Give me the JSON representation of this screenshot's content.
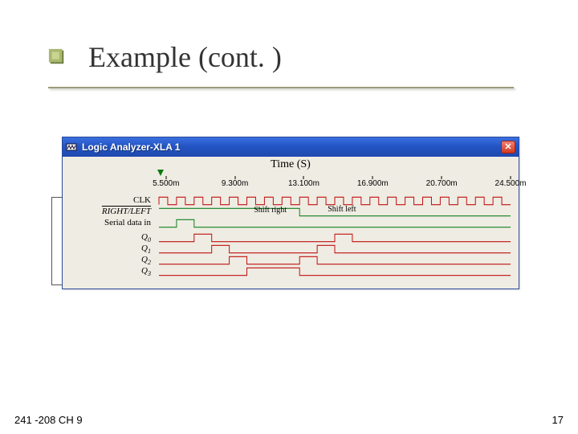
{
  "title": "Example (cont. )",
  "window": {
    "title": "Logic Analyzer-XLA 1",
    "close_glyph": "✕"
  },
  "chart": {
    "title": "Time (S)",
    "ticks": [
      "5.500m",
      "9.300m",
      "13.100m",
      "16.900m",
      "20.700m",
      "24.500m"
    ]
  },
  "signals": {
    "clk": "CLK",
    "rl": "RIGHT/LEFT",
    "sdi": "Serial data in",
    "q0": "Q",
    "q0s": "0",
    "q1": "Q",
    "q1s": "1",
    "q2": "Q",
    "q2s": "2",
    "q3": "Q",
    "q3s": "3"
  },
  "annot": {
    "shift_right": "Shift right",
    "shift_left": "Shift left"
  },
  "footer": {
    "left": "241 -208 CH 9",
    "right": "17"
  },
  "chart_data": {
    "type": "timing-diagram",
    "x_unit": "ms",
    "x_range": [
      5.5,
      24.5
    ],
    "ticks_ms": [
      5.5,
      9.3,
      13.1,
      16.9,
      20.7,
      24.5
    ],
    "signals": [
      {
        "name": "CLK",
        "type": "clock",
        "period_ms": 0.95,
        "color": "#c01010"
      },
      {
        "name": "RIGHT_LEFT",
        "type": "digital",
        "edges_ms": [
          [
            5.5,
            1
          ],
          [
            13.1,
            0
          ]
        ],
        "color": "#108020"
      },
      {
        "name": "Serial_data_in",
        "type": "digital",
        "edges_ms": [
          [
            5.5,
            0
          ],
          [
            6.45,
            1
          ],
          [
            7.4,
            0
          ]
        ],
        "color": "#108020"
      },
      {
        "name": "Q0",
        "type": "digital",
        "edges_ms": [
          [
            5.5,
            0
          ],
          [
            7.4,
            1
          ],
          [
            8.35,
            0
          ],
          [
            15.0,
            1
          ],
          [
            15.95,
            0
          ]
        ],
        "color": "#c01010"
      },
      {
        "name": "Q1",
        "type": "digital",
        "edges_ms": [
          [
            5.5,
            0
          ],
          [
            8.35,
            1
          ],
          [
            9.3,
            0
          ],
          [
            14.05,
            1
          ],
          [
            15.0,
            0
          ]
        ],
        "color": "#c01010"
      },
      {
        "name": "Q2",
        "type": "digital",
        "edges_ms": [
          [
            5.5,
            0
          ],
          [
            9.3,
            1
          ],
          [
            10.25,
            0
          ],
          [
            13.1,
            1
          ],
          [
            14.05,
            0
          ]
        ],
        "color": "#c01010"
      },
      {
        "name": "Q3",
        "type": "digital",
        "edges_ms": [
          [
            5.5,
            0
          ],
          [
            10.25,
            1
          ],
          [
            13.1,
            0
          ]
        ],
        "color": "#c01010"
      }
    ],
    "annotations": [
      {
        "text": "Shift right",
        "x_ms": 11.2,
        "row": "RIGHT_LEFT"
      },
      {
        "text": "Shift left",
        "x_ms": 15.1,
        "row": "RIGHT_LEFT"
      }
    ]
  }
}
